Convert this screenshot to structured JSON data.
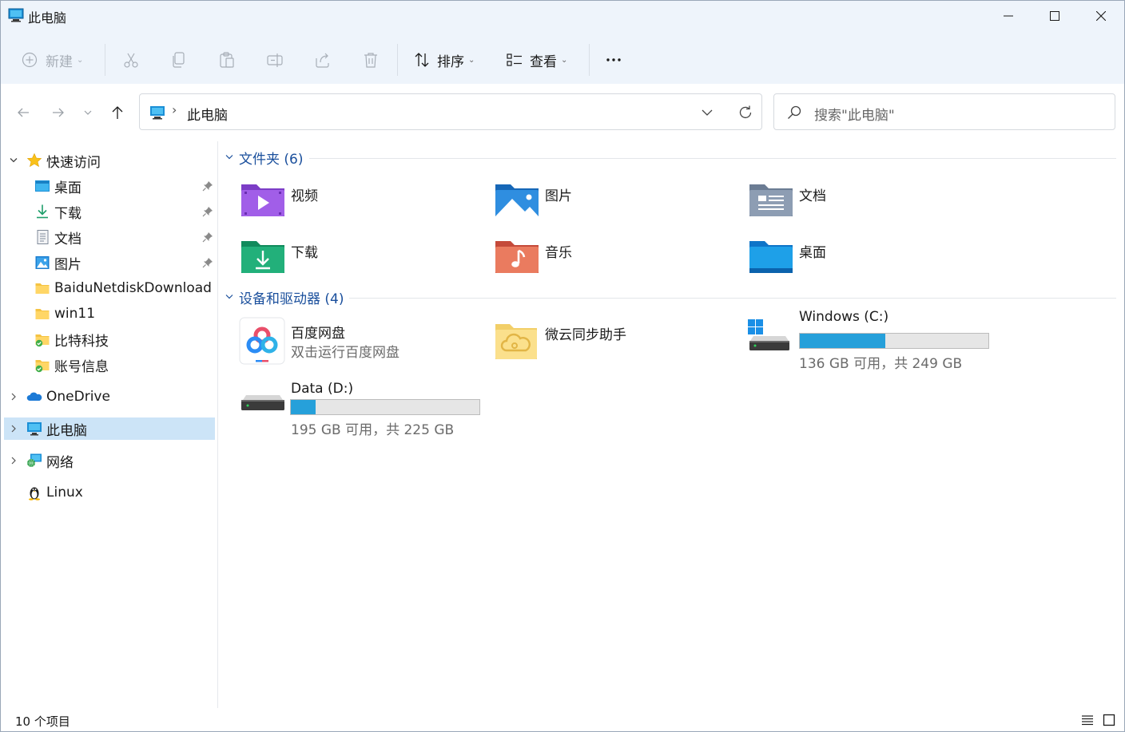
{
  "window": {
    "title": "此电脑",
    "controls": {
      "minimize": "minimize-icon",
      "maximize": "maximize-icon",
      "close": "close-icon"
    }
  },
  "toolbar": {
    "new_label": "新建",
    "sort_label": "排序",
    "view_label": "查看",
    "more_label": "···",
    "icons": [
      "new-icon",
      "cut-icon",
      "copy-icon",
      "paste-icon",
      "rename-icon",
      "share-icon",
      "delete-icon",
      "sort-icon",
      "view-icon",
      "more-icon"
    ]
  },
  "address": {
    "path_label": "此电脑",
    "separator": "›",
    "search_placeholder": "搜索\"此电脑\""
  },
  "sidebar": {
    "quick_access": {
      "label": "快速访问",
      "items": [
        {
          "label": "桌面",
          "pinned": true
        },
        {
          "label": "下载",
          "pinned": true
        },
        {
          "label": "文档",
          "pinned": true
        },
        {
          "label": "图片",
          "pinned": true
        },
        {
          "label": "BaiduNetdiskDownload",
          "pinned": false
        },
        {
          "label": "win11",
          "pinned": false
        },
        {
          "label": "比特科技",
          "pinned": false
        },
        {
          "label": "账号信息",
          "pinned": false
        }
      ]
    },
    "onedrive_label": "OneDrive",
    "this_pc_label": "此电脑",
    "network_label": "网络",
    "linux_label": "Linux"
  },
  "content": {
    "folders_header": "文件夹 (6)",
    "folders": [
      {
        "label": "视频",
        "icon": "videos-folder-icon"
      },
      {
        "label": "图片",
        "icon": "pictures-folder-icon"
      },
      {
        "label": "文档",
        "icon": "documents-folder-icon"
      },
      {
        "label": "下载",
        "icon": "downloads-folder-icon"
      },
      {
        "label": "音乐",
        "icon": "music-folder-icon"
      },
      {
        "label": "桌面",
        "icon": "desktop-folder-icon"
      }
    ],
    "devices_header": "设备和驱动器 (4)",
    "devices": [
      {
        "label": "百度网盘",
        "sub": "双击运行百度网盘"
      },
      {
        "label": "微云同步助手"
      },
      {
        "label": "Windows (C:)",
        "space": "136 GB 可用，共 249 GB",
        "used_fraction": 0.454
      },
      {
        "label": "Data (D:)",
        "space": "195 GB 可用，共 225 GB",
        "used_fraction": 0.133
      }
    ]
  },
  "status": {
    "count": "10 个项目"
  },
  "colors": {
    "accent": "#26a0da",
    "selected_bg": "#cce4f7",
    "section_header": "#1a4f9c",
    "toolbar_bg": "#eef4fb"
  }
}
